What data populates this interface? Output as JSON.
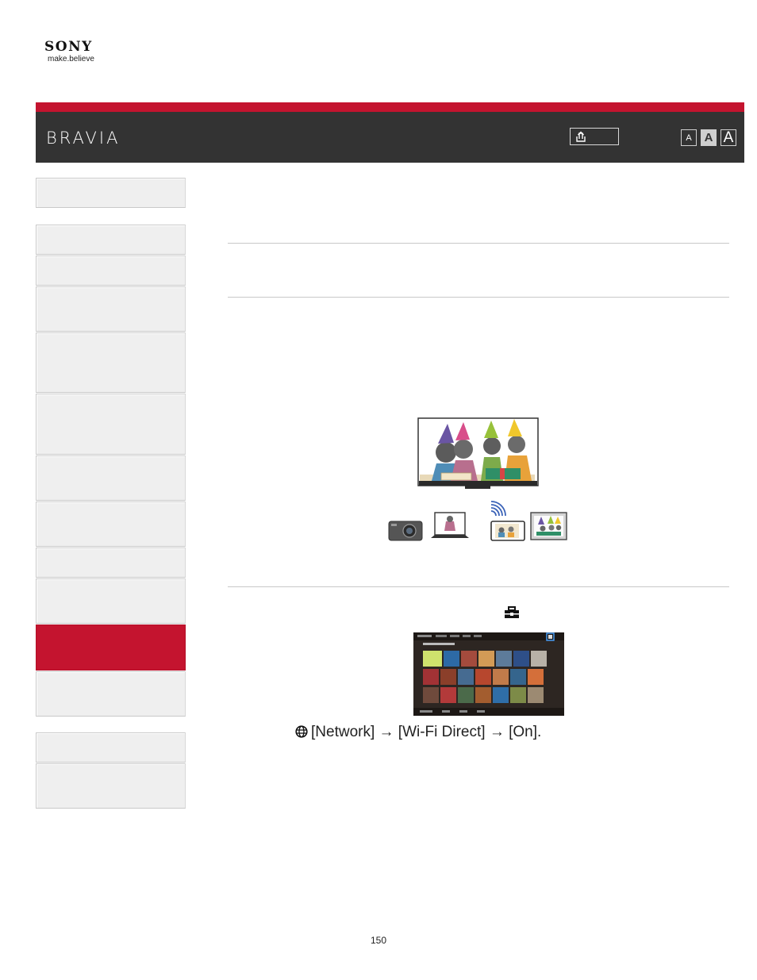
{
  "brand": {
    "name": "SONY",
    "tagline": "make.believe"
  },
  "header": {
    "product_logo": "BRAVIA",
    "print_icon": "print-icon"
  },
  "font_size_buttons": [
    "A",
    "A",
    "A"
  ],
  "sidebar": {
    "active_index": 12
  },
  "content": {
    "menu_path": "[Network] → [Wi-Fi Direct] → [On].",
    "menu_icon": "globe-icon",
    "settings_icon": "toolbox-icon"
  },
  "colors": {
    "accent_red": "#c4142f",
    "header_dark": "#333333",
    "sidebar_bg": "#efefef"
  },
  "footer": {
    "page_number": "150"
  }
}
